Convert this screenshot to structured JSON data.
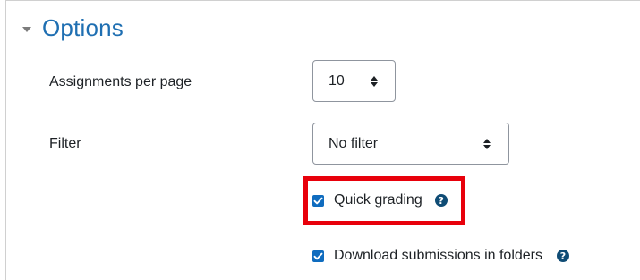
{
  "options": {
    "title": "Options",
    "assignments_per_page": {
      "label": "Assignments per page",
      "value": "10"
    },
    "filter": {
      "label": "Filter",
      "value": "No filter"
    },
    "quick_grading": {
      "label": "Quick grading",
      "checked": true,
      "help_icon": "question-circle-icon"
    },
    "download_in_folders": {
      "label": "Download submissions in folders",
      "checked": true,
      "help_icon": "question-circle-icon"
    }
  },
  "colors": {
    "heading": "#1f6fb2",
    "checkbox": "#0f6cbf",
    "help_icon": "#0f4c75",
    "highlight": "#e8000b"
  }
}
